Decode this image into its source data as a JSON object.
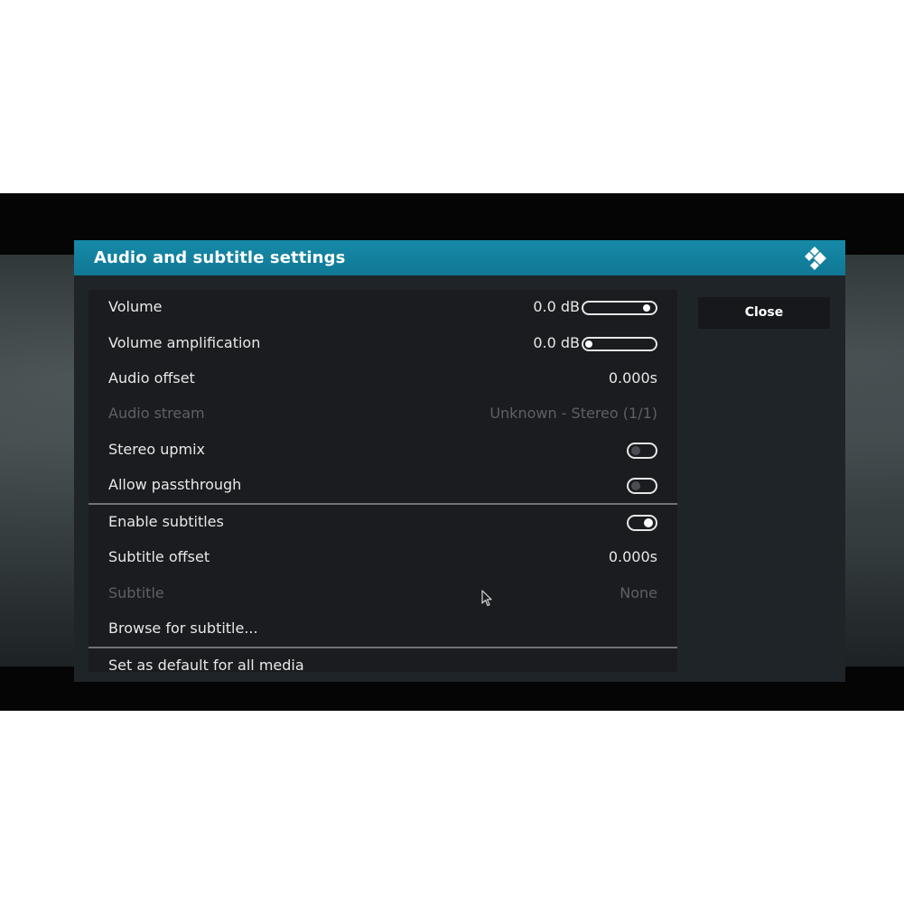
{
  "dialog": {
    "title": "Audio and subtitle settings",
    "logo_icon": "kodi-logo-icon"
  },
  "settings": {
    "volume": {
      "label": "Volume",
      "value": "0.0 dB",
      "level": 1.0
    },
    "volume_amplification": {
      "label": "Volume amplification",
      "value": "0.0 dB",
      "level": 0.0
    },
    "audio_offset": {
      "label": "Audio offset",
      "value": "0.000s"
    },
    "audio_stream": {
      "label": "Audio stream",
      "value": "Unknown - Stereo (1/1)",
      "enabled": false
    },
    "stereo_upmix": {
      "label": "Stereo upmix",
      "toggled": false
    },
    "allow_passthrough": {
      "label": "Allow passthrough",
      "toggled": false
    },
    "enable_subtitles": {
      "label": "Enable subtitles",
      "toggled": true
    },
    "subtitle_offset": {
      "label": "Subtitle offset",
      "value": "0.000s"
    },
    "subtitle": {
      "label": "Subtitle",
      "value": "None",
      "enabled": false
    },
    "browse_for_subtitle": {
      "label": "Browse for subtitle..."
    },
    "set_as_default": {
      "label": "Set as default for all media"
    }
  },
  "buttons": {
    "close_label": "Close"
  },
  "colors": {
    "header": "#12819f",
    "panel": "#1a1c1f",
    "dialog_body": "#1f2428",
    "text": "#e8e8e8",
    "disabled_text": "#5d6165"
  }
}
